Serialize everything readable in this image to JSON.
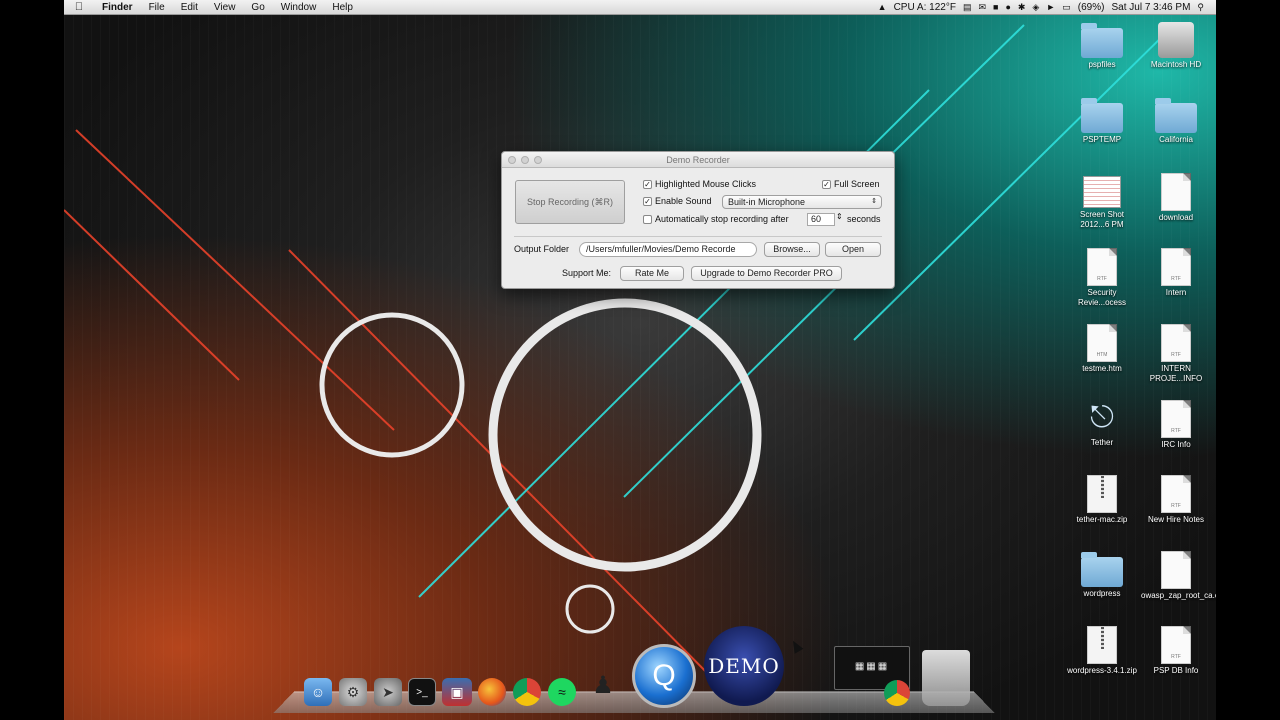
{
  "menubar": {
    "items": [
      "Finder",
      "File",
      "Edit",
      "View",
      "Go",
      "Window",
      "Help"
    ],
    "status": {
      "cpu": "CPU A: 122°F",
      "battery": "(69%)",
      "datetime": "Sat Jul 7  3:46 PM"
    }
  },
  "window": {
    "title": "Demo Recorder",
    "stop_button": "Stop Recording (⌘R)",
    "highlight_clicks": "Highlighted Mouse Clicks",
    "full_screen": "Full Screen",
    "enable_sound": "Enable Sound",
    "mic_select": "Built-in Microphone",
    "auto_stop": "Automatically stop recording after",
    "auto_stop_value": "60",
    "seconds": "seconds",
    "output_folder_label": "Output Folder",
    "output_folder_value": "/Users/mfuller/Movies/Demo Recorde",
    "browse": "Browse...",
    "open": "Open",
    "support_label": "Support Me:",
    "rate_me": "Rate Me",
    "upgrade": "Upgrade to Demo Recorder PRO"
  },
  "desktop": {
    "icons": [
      {
        "label": "pspfiles",
        "kind": "folder"
      },
      {
        "label": "Macintosh HD",
        "kind": "drive"
      },
      {
        "label": "PSPTEMP",
        "kind": "folder"
      },
      {
        "label": "California",
        "kind": "folder"
      },
      {
        "label": "Screen Shot 2012...6 PM",
        "kind": "screenshot"
      },
      {
        "label": "download",
        "kind": "doc",
        "tag": ""
      },
      {
        "label": "Security Revie...ocess",
        "kind": "doc",
        "tag": "RTF"
      },
      {
        "label": "Intern",
        "kind": "doc",
        "tag": "RTF"
      },
      {
        "label": "testme.htm",
        "kind": "doc",
        "tag": "HTM"
      },
      {
        "label": "INTERN PROJE...INFO",
        "kind": "doc",
        "tag": "RTF"
      },
      {
        "label": "Tether",
        "kind": "usb"
      },
      {
        "label": "IRC Info",
        "kind": "doc",
        "tag": "RTF"
      },
      {
        "label": "tether-mac.zip",
        "kind": "zip"
      },
      {
        "label": "New Hire Notes",
        "kind": "doc",
        "tag": "RTF"
      },
      {
        "label": "wordpress",
        "kind": "folder"
      },
      {
        "label": "owasp_zap_root_ca.cer",
        "kind": "doc",
        "tag": ""
      },
      {
        "label": "wordpress-3.4.1.zip",
        "kind": "zip"
      },
      {
        "label": "PSP DB Info",
        "kind": "doc",
        "tag": "RTF"
      }
    ]
  },
  "dock": {
    "demo_label": "DEMO"
  }
}
